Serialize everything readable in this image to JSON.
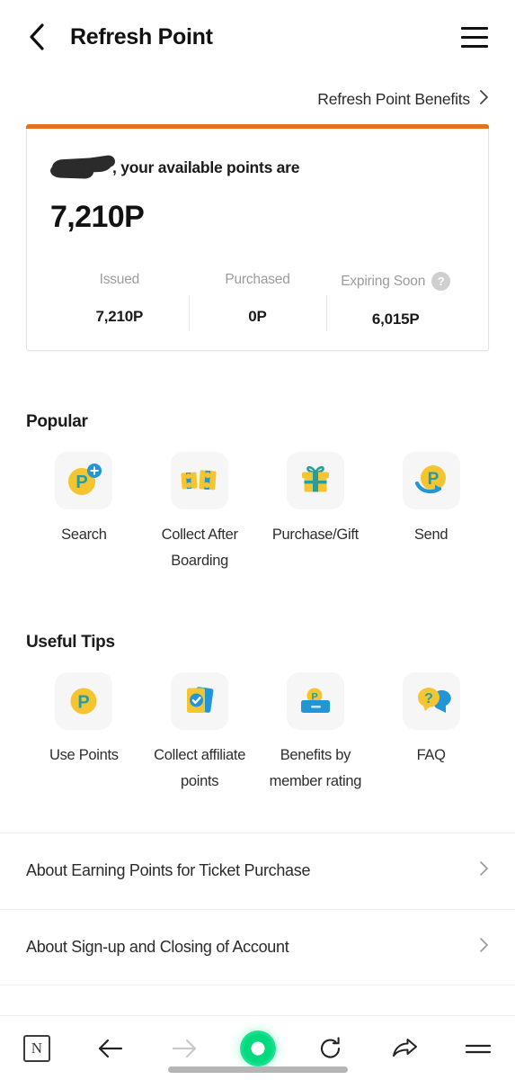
{
  "header": {
    "back_icon": "chevron-left-icon",
    "title": "Refresh Point",
    "menu_icon": "hamburger-menu-icon"
  },
  "benefits": {
    "label": "Refresh Point Benefits",
    "chevron_icon": "chevron-right-icon"
  },
  "points_card": {
    "accent_color": "#e8701a",
    "greeting_suffix": ", your available points are",
    "redacted_name": "",
    "total_points": "7,210P",
    "stats": [
      {
        "label": "Issued",
        "value": "7,210P",
        "has_help": false
      },
      {
        "label": "Purchased",
        "value": "0P",
        "has_help": false
      },
      {
        "label": "Expiring Soon",
        "value": "6,015P",
        "has_help": true,
        "help_glyph": "?"
      }
    ]
  },
  "popular": {
    "title": "Popular",
    "tiles": [
      {
        "label": "Search",
        "icon": "point-coin-plus-icon"
      },
      {
        "label": "Collect After Boarding",
        "icon": "ticket-stack-icon"
      },
      {
        "label": "Purchase/Gift",
        "icon": "gift-box-icon"
      },
      {
        "label": "Send",
        "icon": "point-coin-arrow-icon"
      }
    ]
  },
  "useful_tips": {
    "title": "Useful Tips",
    "tiles": [
      {
        "label": "Use Points",
        "icon": "point-coin-icon"
      },
      {
        "label": "Collect affiliate points",
        "icon": "cards-check-icon"
      },
      {
        "label": "Benefits by member rating",
        "icon": "membership-card-coin-icon"
      },
      {
        "label": "FAQ",
        "icon": "question-speech-bubbles-icon"
      }
    ]
  },
  "link_rows": [
    {
      "label": "About Earning Points for Ticket Purchase",
      "chevron_icon": "chevron-right-icon"
    },
    {
      "label": "About Sign-up and Closing of Account",
      "chevron_icon": "chevron-right-icon"
    }
  ],
  "bottom_nav": {
    "items": [
      {
        "name": "naver-home",
        "icon": "naver-n-logo-icon",
        "glyph": "N",
        "enabled": true
      },
      {
        "name": "back",
        "icon": "arrow-left-icon",
        "enabled": true
      },
      {
        "name": "forward",
        "icon": "arrow-right-icon",
        "enabled": false
      },
      {
        "name": "home-green",
        "icon": "green-ring-icon",
        "enabled": true
      },
      {
        "name": "reload",
        "icon": "refresh-icon",
        "enabled": true
      },
      {
        "name": "share",
        "icon": "share-arrow-icon",
        "enabled": true
      },
      {
        "name": "menu",
        "icon": "equals-menu-icon",
        "enabled": true
      }
    ],
    "accent_color": "#05d97e"
  }
}
